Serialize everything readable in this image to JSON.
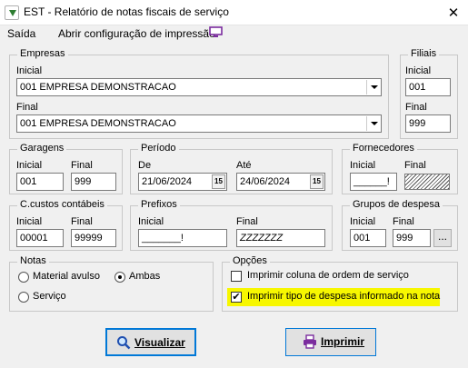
{
  "window": {
    "title": "EST - Relatório de notas fiscais de serviço",
    "close_glyph": "✕"
  },
  "menu": {
    "items": [
      {
        "label": "Saída"
      },
      {
        "label": "Abrir configuração de impressão"
      }
    ],
    "print_config_icon": "monitor-icon"
  },
  "empresas": {
    "group_label": "Empresas",
    "inicial_label": "Inicial",
    "inicial_value": "001 EMPRESA DEMONSTRACAO",
    "final_label": "Final",
    "final_value": "001 EMPRESA DEMONSTRACAO"
  },
  "filiais": {
    "group_label": "Filiais",
    "inicial_label": "Inicial",
    "inicial_value": "001",
    "final_label": "Final",
    "final_value": "999"
  },
  "garagens": {
    "group_label": "Garagens",
    "inicial_label": "Inicial",
    "inicial_value": "001",
    "final_label": "Final",
    "final_value": "999"
  },
  "periodo": {
    "group_label": "Período",
    "de_label": "De",
    "de_value": "21/06/2024",
    "ate_label": "Até",
    "ate_value": "24/06/2024",
    "calendar_glyph": "15"
  },
  "fornecedores": {
    "group_label": "Fornecedores",
    "inicial_label": "Inicial",
    "inicial_value": "______!",
    "final_label": "Final"
  },
  "ccustos": {
    "group_label": "C.custos contábeis",
    "inicial_label": "Inicial",
    "inicial_value": "00001",
    "final_label": "Final",
    "final_value": "99999"
  },
  "prefixos": {
    "group_label": "Prefixos",
    "inicial_label": "Inicial",
    "inicial_value": "_______!",
    "final_label": "Final",
    "final_value": "ZZZZZZZ"
  },
  "grupos_despesa": {
    "group_label": "Grupos de despesa",
    "inicial_label": "Inicial",
    "inicial_value": "001",
    "final_label": "Final",
    "final_value": "999",
    "browse_label": "..."
  },
  "notas": {
    "group_label": "Notas",
    "options": [
      {
        "label": "Material avulso",
        "selected": false
      },
      {
        "label": "Ambas",
        "selected": true
      },
      {
        "label": "Serviço",
        "selected": false
      }
    ]
  },
  "opcoes": {
    "group_label": "Opções",
    "checkboxes": [
      {
        "label": "Imprimir coluna de ordem de serviço",
        "checked": false
      },
      {
        "label": "Imprimir tipo de despesa informado na nota",
        "checked": true,
        "highlight_color": "#f7f700"
      }
    ],
    "check_glyph": "✔"
  },
  "buttons": {
    "visualizar": "Visualizar",
    "imprimir": "Imprimir"
  },
  "colors": {
    "accent": "#0078d7",
    "highlight": "#f7f700",
    "print_icon": "#7b2c9e"
  }
}
